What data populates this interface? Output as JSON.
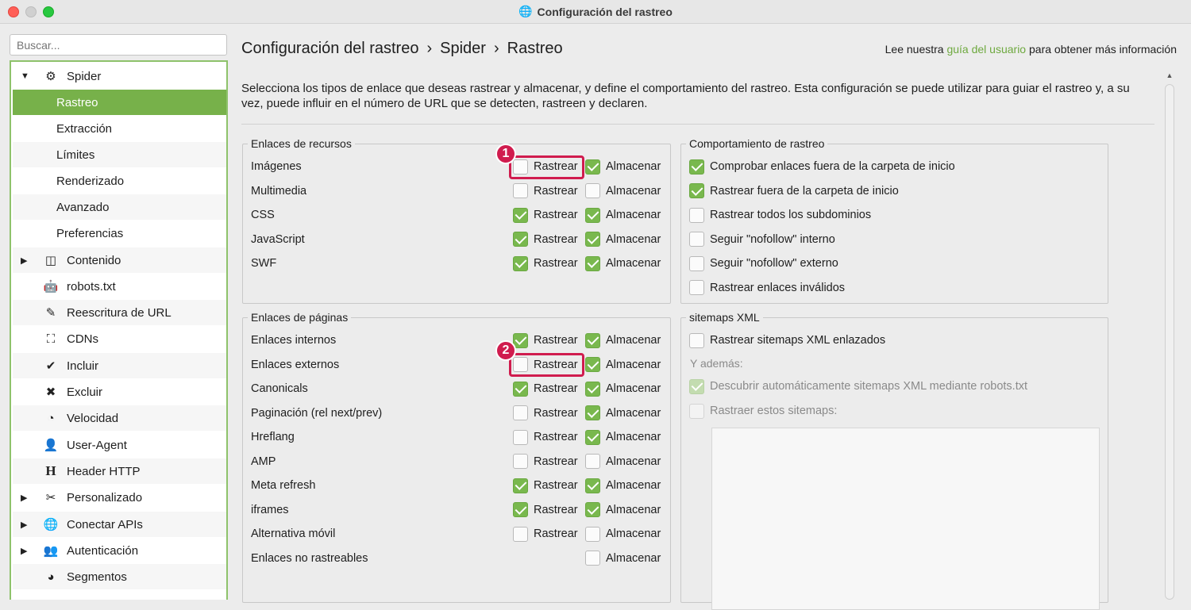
{
  "window": {
    "title": "Configuración del rastreo",
    "title_icon": "globe-icon"
  },
  "search": {
    "placeholder": "Buscar..."
  },
  "sidebar": {
    "items": [
      {
        "label": "Spider",
        "icon": "⚙",
        "arrow": "▼"
      },
      {
        "label": "Rastreo"
      },
      {
        "label": "Extracción"
      },
      {
        "label": "Límites"
      },
      {
        "label": "Renderizado"
      },
      {
        "label": "Avanzado"
      },
      {
        "label": "Preferencias"
      },
      {
        "label": "Contenido",
        "icon": "◫",
        "arrow": "▶"
      },
      {
        "label": "robots.txt",
        "icon": "🤖"
      },
      {
        "label": "Reescritura de URL",
        "icon": "✎"
      },
      {
        "label": "CDNs",
        "icon": "⛶"
      },
      {
        "label": "Incluir",
        "icon": "✔"
      },
      {
        "label": "Excluir",
        "icon": "✖"
      },
      {
        "label": "Velocidad",
        "icon": "◔"
      },
      {
        "label": "User-Agent",
        "icon": "👤"
      },
      {
        "label": "Header HTTP",
        "icon": "H"
      },
      {
        "label": "Personalizado",
        "icon": "✂",
        "arrow": "▶"
      },
      {
        "label": "Conectar APIs",
        "icon": "🌐",
        "arrow": "▶"
      },
      {
        "label": "Autenticación",
        "icon": "👥",
        "arrow": "▶"
      },
      {
        "label": "Segmentos",
        "icon": "◕"
      }
    ]
  },
  "breadcrumb": {
    "part1": "Configuración del rastreo",
    "part2": "Spider",
    "part3": "Rastreo",
    "sep": "›"
  },
  "help": {
    "pre": "Lee nuestra",
    "link": "guía del usuario",
    "post": "para obtener más información"
  },
  "description": "Selecciona los tipos de enlace que deseas rastrear y almacenar, y define el comportamiento del rastreo. Esta configuración se puede utilizar para guiar el rastreo y, a su vez, puede influir en el número de URL que se detecten, rastreen y declaren.",
  "labels": {
    "crawl": "Rastrear",
    "store": "Almacenar"
  },
  "resource_links": {
    "title": "Enlaces de recursos",
    "rows": [
      {
        "label": "Imágenes",
        "crawl": false,
        "store": true
      },
      {
        "label": "Multimedia",
        "crawl": false,
        "store": false
      },
      {
        "label": "CSS",
        "crawl": true,
        "store": true
      },
      {
        "label": "JavaScript",
        "crawl": true,
        "store": true
      },
      {
        "label": "SWF",
        "crawl": true,
        "store": true
      }
    ]
  },
  "page_links": {
    "title": "Enlaces de páginas",
    "rows": [
      {
        "label": "Enlaces internos",
        "crawl": true,
        "store": true
      },
      {
        "label": "Enlaces externos",
        "crawl": false,
        "store": true
      },
      {
        "label": "Canonicals",
        "crawl": true,
        "store": true
      },
      {
        "label": "Paginación (rel next/prev)",
        "crawl": false,
        "store": true
      },
      {
        "label": "Hreflang",
        "crawl": false,
        "store": true
      },
      {
        "label": "AMP",
        "crawl": false,
        "store": false
      },
      {
        "label": "Meta refresh",
        "crawl": true,
        "store": true
      },
      {
        "label": "iframes",
        "crawl": true,
        "store": true
      },
      {
        "label": "Alternativa móvil",
        "crawl": false,
        "store": false
      },
      {
        "label": "Enlaces no rastreables",
        "crawl": null,
        "store": false
      }
    ]
  },
  "crawl_behavior": {
    "title": "Comportamiento de rastreo",
    "rows": [
      {
        "label": "Comprobar enlaces fuera de la carpeta de inicio",
        "checked": true
      },
      {
        "label": "Rastrear fuera de la carpeta de inicio",
        "checked": true
      },
      {
        "label": "Rastrear todos los subdominios",
        "checked": false
      },
      {
        "label": "Seguir \"nofollow\" interno",
        "checked": false
      },
      {
        "label": "Seguir \"nofollow\" externo",
        "checked": false
      },
      {
        "label": "Rastrear enlaces inválidos",
        "checked": false
      }
    ]
  },
  "sitemaps": {
    "title": "sitemaps XML",
    "crawl_linked": "Rastrear sitemaps XML enlazados",
    "also": "Y además:",
    "auto_discover": "Descubrir automáticamente sitemaps XML mediante robots.txt",
    "crawl_these": "Rastraer estos sitemaps:"
  },
  "annotations": {
    "badge1": "1",
    "badge2": "2"
  },
  "colors": {
    "accent": "#77b14a",
    "highlight": "#d01c4e"
  }
}
